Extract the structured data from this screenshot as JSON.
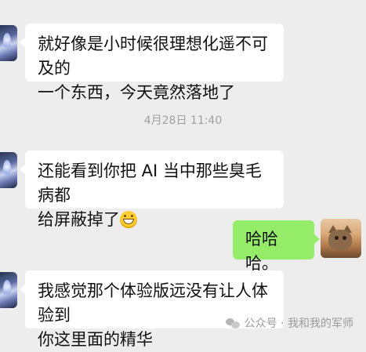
{
  "messages": [
    {
      "sender": "other",
      "text_lines": [
        "就好像是小时候很理想化遥不可及的",
        "一个东西，今天竟然落地了"
      ]
    },
    {
      "sender": "other",
      "text_lines": [
        "还能看到你把 AI 当中那些臭毛病都",
        "给屏蔽掉了"
      ],
      "emoji": "grinning-emoji"
    },
    {
      "sender": "self",
      "text_lines": [
        "哈哈哈。"
      ]
    },
    {
      "sender": "other",
      "text_lines": [
        "我感觉那个体验版远没有让人体验到",
        "你这里面的精华"
      ]
    }
  ],
  "timestamp": "4月28日 11:40",
  "watermark": {
    "label": "公众号 · 我和我的军师",
    "icon": "wechat-official-account-icon"
  },
  "colors": {
    "background": "#ededed",
    "incoming_bubble": "#ffffff",
    "outgoing_bubble": "#95ec69",
    "timestamp_text": "#a0a0a0"
  }
}
